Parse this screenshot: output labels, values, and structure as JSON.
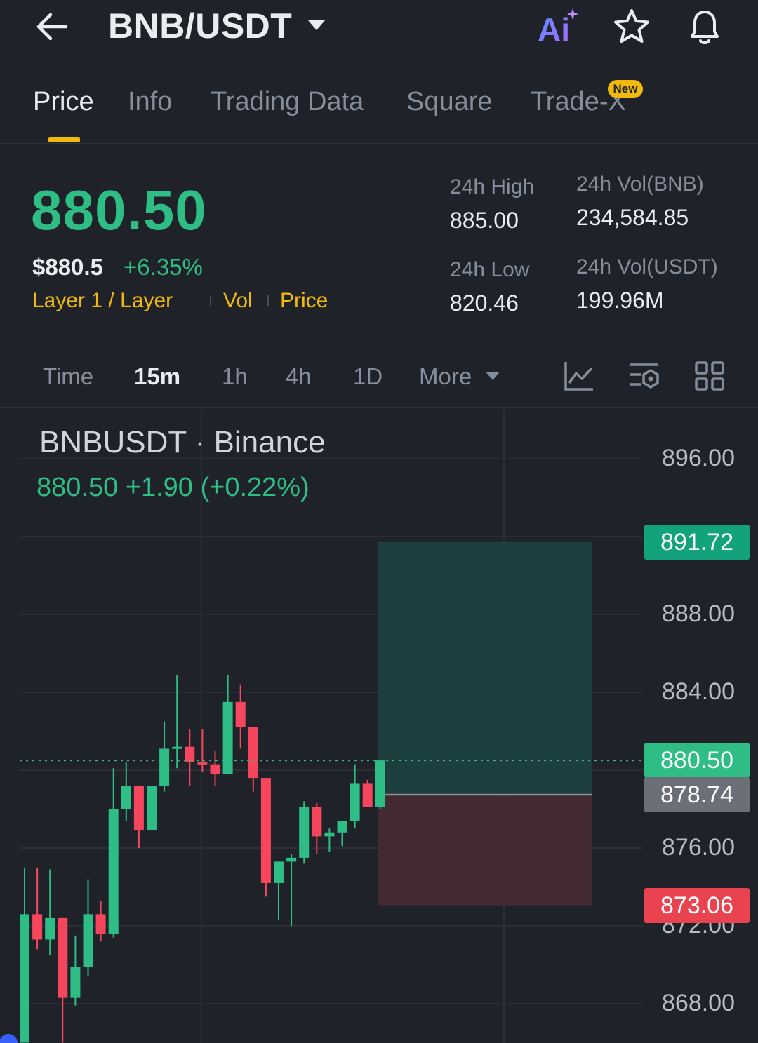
{
  "header": {
    "pair": "BNB/USDT",
    "icons": {
      "back": "arrow-left-icon",
      "dropdown": "caret-down-icon",
      "ai": "ai-assistant-icon",
      "favorite": "star-icon",
      "alert": "bell-icon"
    },
    "ai_label": "Ai"
  },
  "tabs": [
    {
      "label": "Price",
      "active": true
    },
    {
      "label": "Info",
      "active": false
    },
    {
      "label": "Trading Data",
      "active": false
    },
    {
      "label": "Square",
      "active": false
    },
    {
      "label": "Trade-X",
      "active": false
    }
  ],
  "new_badge": "New",
  "ticker": {
    "last_price": "880.50",
    "usd_price": "$880.5",
    "change_pct": "+6.35%",
    "tags": [
      "Layer 1 / Layer",
      "Vol",
      "Price"
    ],
    "stats": {
      "high_label": "24h High",
      "high_value": "885.00",
      "low_label": "24h Low",
      "low_value": "820.46",
      "vol_base_label": "24h Vol(BNB)",
      "vol_base_value": "234,584.85",
      "vol_quote_label": "24h Vol(USDT)",
      "vol_quote_value": "199.96M"
    }
  },
  "intervals": {
    "items": [
      "Time",
      "15m",
      "1h",
      "4h",
      "1D",
      "More"
    ],
    "active": "15m",
    "tools": [
      "chart-style-icon",
      "indicator-settings-icon",
      "layout-grid-icon"
    ]
  },
  "chart": {
    "legend_title": "BNBUSDT · Binance",
    "legend_values": "880.50  +1.90 (+0.22%)",
    "price_badges": {
      "take_profit": "891.72",
      "current": "880.50",
      "entry": "878.74",
      "stop_loss": "873.06"
    },
    "colors": {
      "up": "#2ebd85",
      "down": "#f6465d",
      "tp_zone": "#1d4040",
      "sl_zone": "#462a33",
      "grid": "#2b3038"
    }
  },
  "chart_data": {
    "type": "candlestick",
    "title": "BNBUSDT · Binance",
    "interval": "15m",
    "y_ticks": [
      896.0,
      888.0,
      884.0,
      876.0,
      872.0,
      868.0
    ],
    "y_tick_labels": [
      "896.00",
      "888.00",
      "884.00",
      "876.00",
      "872.00",
      "868.00"
    ],
    "ylim": [
      866.0,
      898.0
    ],
    "last_price": 880.5,
    "position": {
      "take_profit": 891.72,
      "entry": 878.74,
      "stop_loss": 873.06
    },
    "candles": [
      {
        "o": 866.0,
        "h": 875.0,
        "l": 866.0,
        "c": 872.6
      },
      {
        "o": 872.6,
        "h": 875.0,
        "l": 870.8,
        "c": 871.3
      },
      {
        "o": 871.3,
        "h": 874.9,
        "l": 870.5,
        "c": 872.4
      },
      {
        "o": 872.4,
        "h": 872.4,
        "l": 866.0,
        "c": 868.3
      },
      {
        "o": 868.3,
        "h": 871.5,
        "l": 867.9,
        "c": 869.9
      },
      {
        "o": 869.9,
        "h": 874.4,
        "l": 869.4,
        "c": 872.6
      },
      {
        "o": 872.6,
        "h": 873.3,
        "l": 871.2,
        "c": 871.6
      },
      {
        "o": 871.6,
        "h": 880.1,
        "l": 871.4,
        "c": 878.0
      },
      {
        "o": 878.0,
        "h": 880.4,
        "l": 877.4,
        "c": 879.2
      },
      {
        "o": 879.2,
        "h": 879.2,
        "l": 876.0,
        "c": 876.9
      },
      {
        "o": 876.9,
        "h": 879.2,
        "l": 876.9,
        "c": 879.2
      },
      {
        "o": 879.2,
        "h": 882.5,
        "l": 878.9,
        "c": 881.1
      },
      {
        "o": 881.1,
        "h": 884.9,
        "l": 880.1,
        "c": 881.2
      },
      {
        "o": 881.2,
        "h": 882.1,
        "l": 879.2,
        "c": 880.4
      },
      {
        "o": 880.4,
        "h": 882.1,
        "l": 879.9,
        "c": 880.3
      },
      {
        "o": 880.3,
        "h": 881.0,
        "l": 879.2,
        "c": 879.8
      },
      {
        "o": 879.8,
        "h": 884.9,
        "l": 880.0,
        "c": 883.5
      },
      {
        "o": 883.5,
        "h": 884.4,
        "l": 881.1,
        "c": 882.2
      },
      {
        "o": 882.2,
        "h": 882.2,
        "l": 878.9,
        "c": 879.6
      },
      {
        "o": 879.6,
        "h": 879.6,
        "l": 873.5,
        "c": 874.2
      },
      {
        "o": 874.2,
        "h": 875.3,
        "l": 872.3,
        "c": 875.3
      },
      {
        "o": 875.3,
        "h": 875.7,
        "l": 872.0,
        "c": 875.5
      },
      {
        "o": 875.5,
        "h": 878.4,
        "l": 875.2,
        "c": 878.1
      },
      {
        "o": 878.1,
        "h": 878.3,
        "l": 875.7,
        "c": 876.6
      },
      {
        "o": 876.6,
        "h": 877.0,
        "l": 875.8,
        "c": 876.8
      },
      {
        "o": 876.8,
        "h": 876.8,
        "l": 876.1,
        "c": 877.4
      },
      {
        "o": 877.4,
        "h": 880.3,
        "l": 877.0,
        "c": 879.3
      },
      {
        "o": 879.3,
        "h": 879.5,
        "l": 878.1,
        "c": 878.1
      },
      {
        "o": 878.1,
        "h": 880.5,
        "l": 878.0,
        "c": 880.5
      }
    ]
  }
}
